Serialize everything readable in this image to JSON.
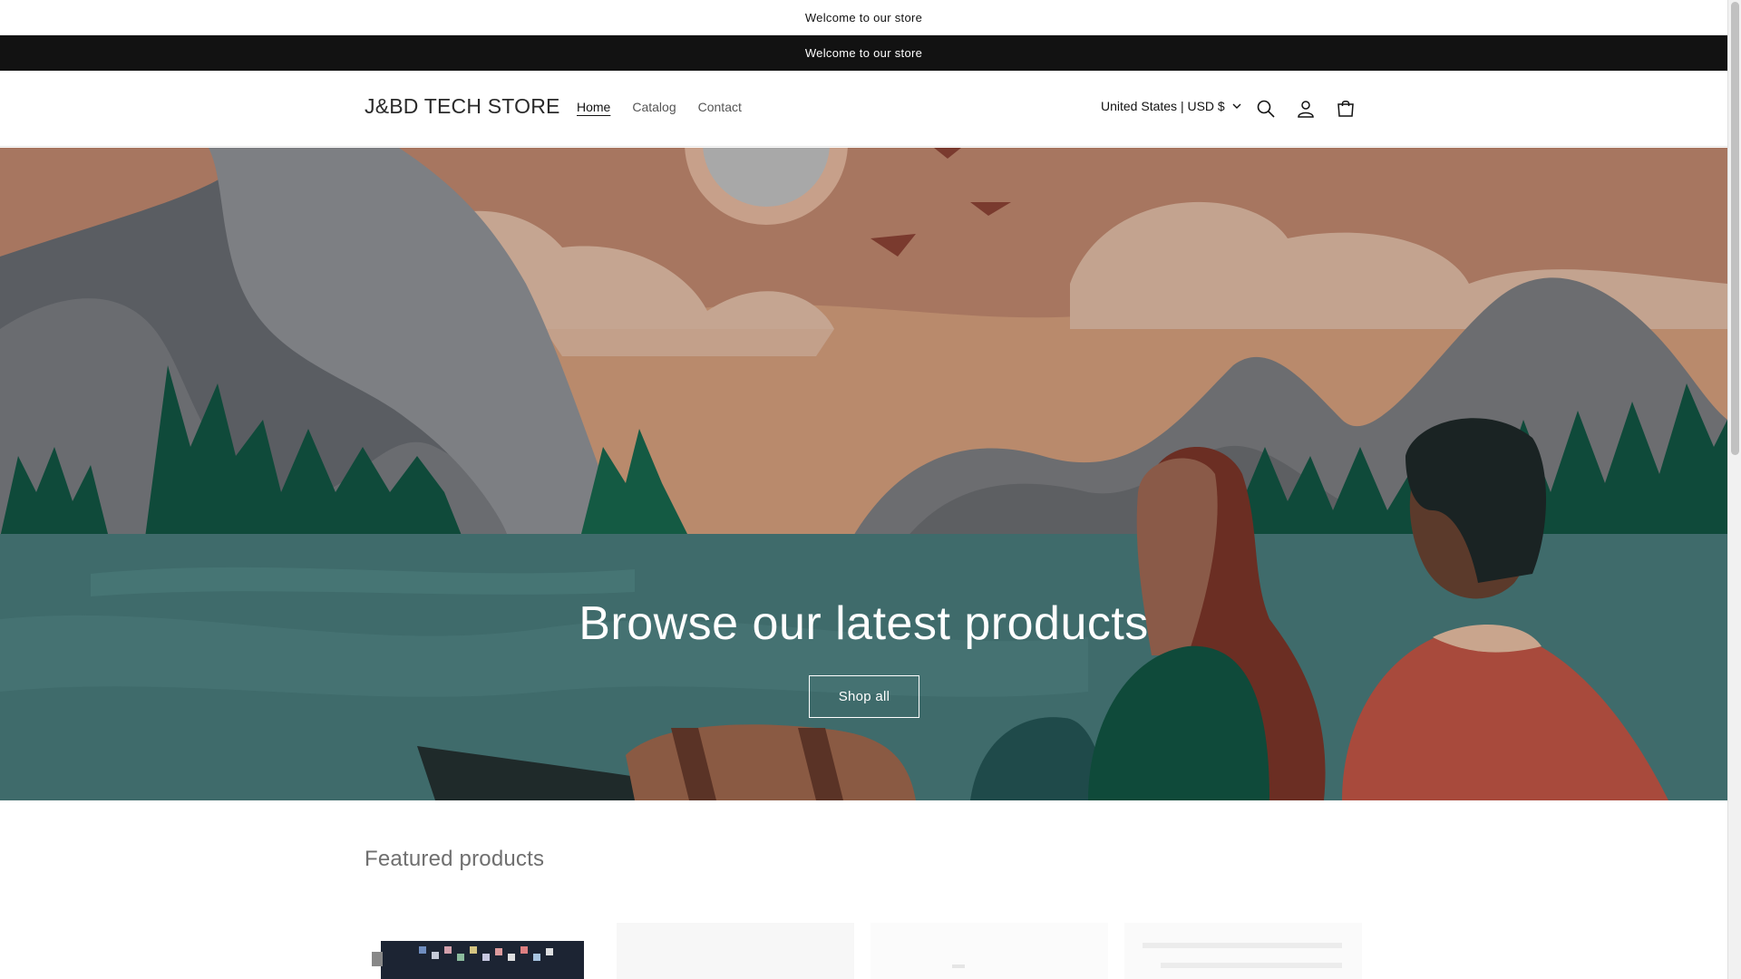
{
  "announcements": [
    "Welcome to our store",
    "Welcome to our store"
  ],
  "header": {
    "logo": "J&BD TECH STORE",
    "nav": [
      {
        "label": "Home",
        "active": true
      },
      {
        "label": "Catalog",
        "active": false
      },
      {
        "label": "Contact",
        "active": false
      }
    ],
    "locale": "United States | USD $",
    "icons": [
      "search-icon",
      "account-icon",
      "cart-icon"
    ]
  },
  "hero": {
    "title": "Browse our latest products",
    "button": "Shop all"
  },
  "featured": {
    "title": "Featured products"
  },
  "colors": {
    "announcement_dark": "#121212",
    "lake": "#3f6b6b",
    "sky": "#b98a6c",
    "forest": "#0f4a3a"
  }
}
